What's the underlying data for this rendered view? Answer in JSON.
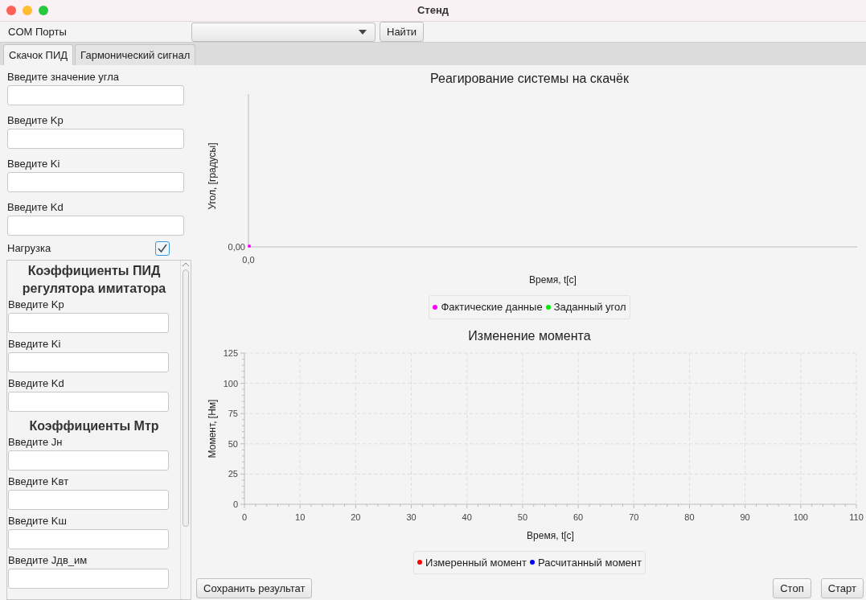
{
  "window": {
    "title": "Стенд"
  },
  "toolbar": {
    "label": "COM Порты",
    "find_button": "Найти"
  },
  "tabs": [
    {
      "label": "Скачок ПИД",
      "selected": true
    },
    {
      "label": "Гармонический сигнал",
      "selected": false
    }
  ],
  "left_panel": {
    "fields": [
      {
        "label": "Введите значение угла"
      },
      {
        "label": "Введите Kp"
      },
      {
        "label": "Введите Ki"
      },
      {
        "label": "Введите Kd"
      }
    ],
    "load": {
      "label": "Нагрузка",
      "checked": true
    },
    "scroll_pane": [
      {
        "kind": "heading",
        "text": "Коэффициенты ПИД регулятора имитатора"
      },
      {
        "kind": "field",
        "label": "Введите Kp"
      },
      {
        "kind": "field",
        "label": "Введите Ki"
      },
      {
        "kind": "field",
        "label": "Введите Kd"
      },
      {
        "kind": "heading",
        "text": "Коэффициенты Мтр"
      },
      {
        "kind": "field",
        "label": "Введите Jн"
      },
      {
        "kind": "field",
        "label": "Введите Kвт"
      },
      {
        "kind": "field",
        "label": "Введите Kш"
      },
      {
        "kind": "field",
        "label": "Введите Jдв_им"
      }
    ]
  },
  "step_chart": {
    "title": "Реагирование системы на скачёк",
    "xlabel": "Время, t[c]",
    "ylabel": "Угол, [градусы]",
    "x_tick": "0,0",
    "y_tick": "0,00",
    "legend": [
      {
        "name": "Фактические данные",
        "color": "#ff00ff"
      },
      {
        "name": "Заданный угол",
        "color": "#00ee00"
      }
    ]
  },
  "torque_chart": {
    "chart_data": {
      "type": "line",
      "title": "Изменение момента",
      "xlabel": "Время, t[c]",
      "ylabel": "Момент, [Нм]",
      "categories": [
        "0",
        "10",
        "20",
        "30",
        "40",
        "50",
        "60",
        "70",
        "80",
        "90",
        "100",
        "110"
      ],
      "ylim": [
        0,
        125
      ],
      "grid": true,
      "series": [
        {
          "name": "Измеренный момент",
          "color": "#ff0000",
          "values": [
            null,
            null,
            null,
            null,
            null,
            null,
            null,
            null,
            null,
            null,
            null,
            null
          ]
        },
        {
          "name": "Расчитанный момент",
          "color": "#0000ff",
          "values": [
            null,
            null,
            null,
            null,
            null,
            null,
            null,
            null,
            null,
            null,
            null,
            null
          ]
        }
      ],
      "yticks": [
        0,
        25,
        50,
        75,
        100,
        125
      ]
    }
  },
  "buttons": {
    "save": "Сохранить результат",
    "stop": "Стоп",
    "start": "Старт"
  }
}
